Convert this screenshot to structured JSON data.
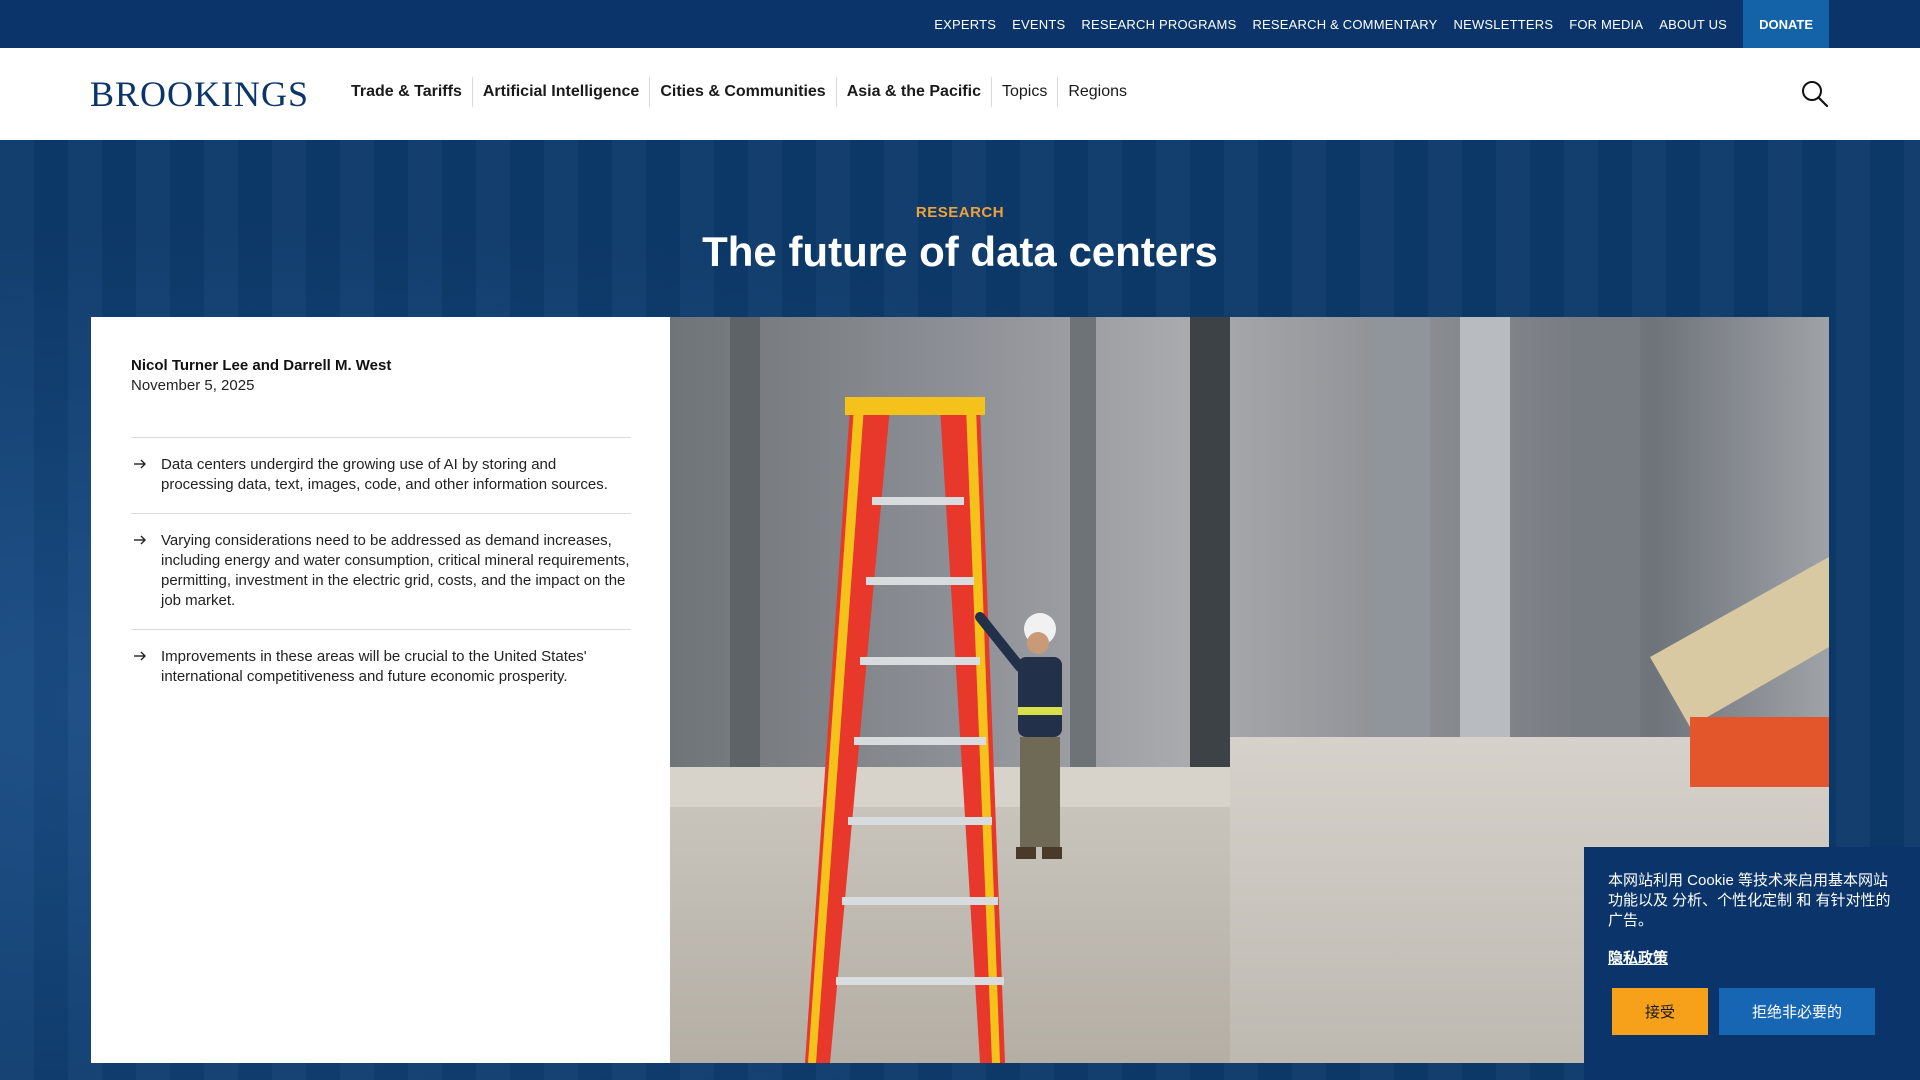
{
  "utility_nav": {
    "items": [
      "EXPERTS",
      "EVENTS",
      "RESEARCH PROGRAMS",
      "RESEARCH & COMMENTARY",
      "NEWSLETTERS",
      "FOR MEDIA",
      "ABOUT US"
    ],
    "donate_label": "DONATE"
  },
  "header": {
    "logo_text": "BROOKINGS",
    "nav": [
      {
        "label": "Trade & Tariffs"
      },
      {
        "label": "Artificial Intelligence"
      },
      {
        "label": "Cities & Communities"
      },
      {
        "label": "Asia & the Pacific"
      },
      {
        "label": "Topics"
      },
      {
        "label": "Regions"
      }
    ],
    "search_icon": "search-icon"
  },
  "hero": {
    "eyebrow": "RESEARCH",
    "title": "The future of data centers"
  },
  "article": {
    "authors": "Nicol Turner Lee and Darrell M. West",
    "date": "November 5, 2025",
    "takeaways": [
      "Data centers undergird the growing use of AI by storing and processing data, text, images, code, and other information sources.",
      "Varying considerations need to be addressed as demand increases, including energy and water consumption, critical mineral requirements, permitting, investment in the electric grid, costs, and the impact on the job market.",
      "Improvements in these areas will be crucial to the United States' international competitiveness and future economic prosperity."
    ]
  },
  "cookie": {
    "text": "本网站利用 Cookie 等技术来启用基本网站功能以及 分析、个性化定制 和 有针对性的广告。",
    "privacy_link": "隐私政策",
    "accept_label": "接受",
    "reject_label": "拒绝非必要的"
  },
  "colors": {
    "brand_navy": "#0b356a",
    "accent_orange": "#f0a23a",
    "donate_blue": "#1462a8"
  }
}
